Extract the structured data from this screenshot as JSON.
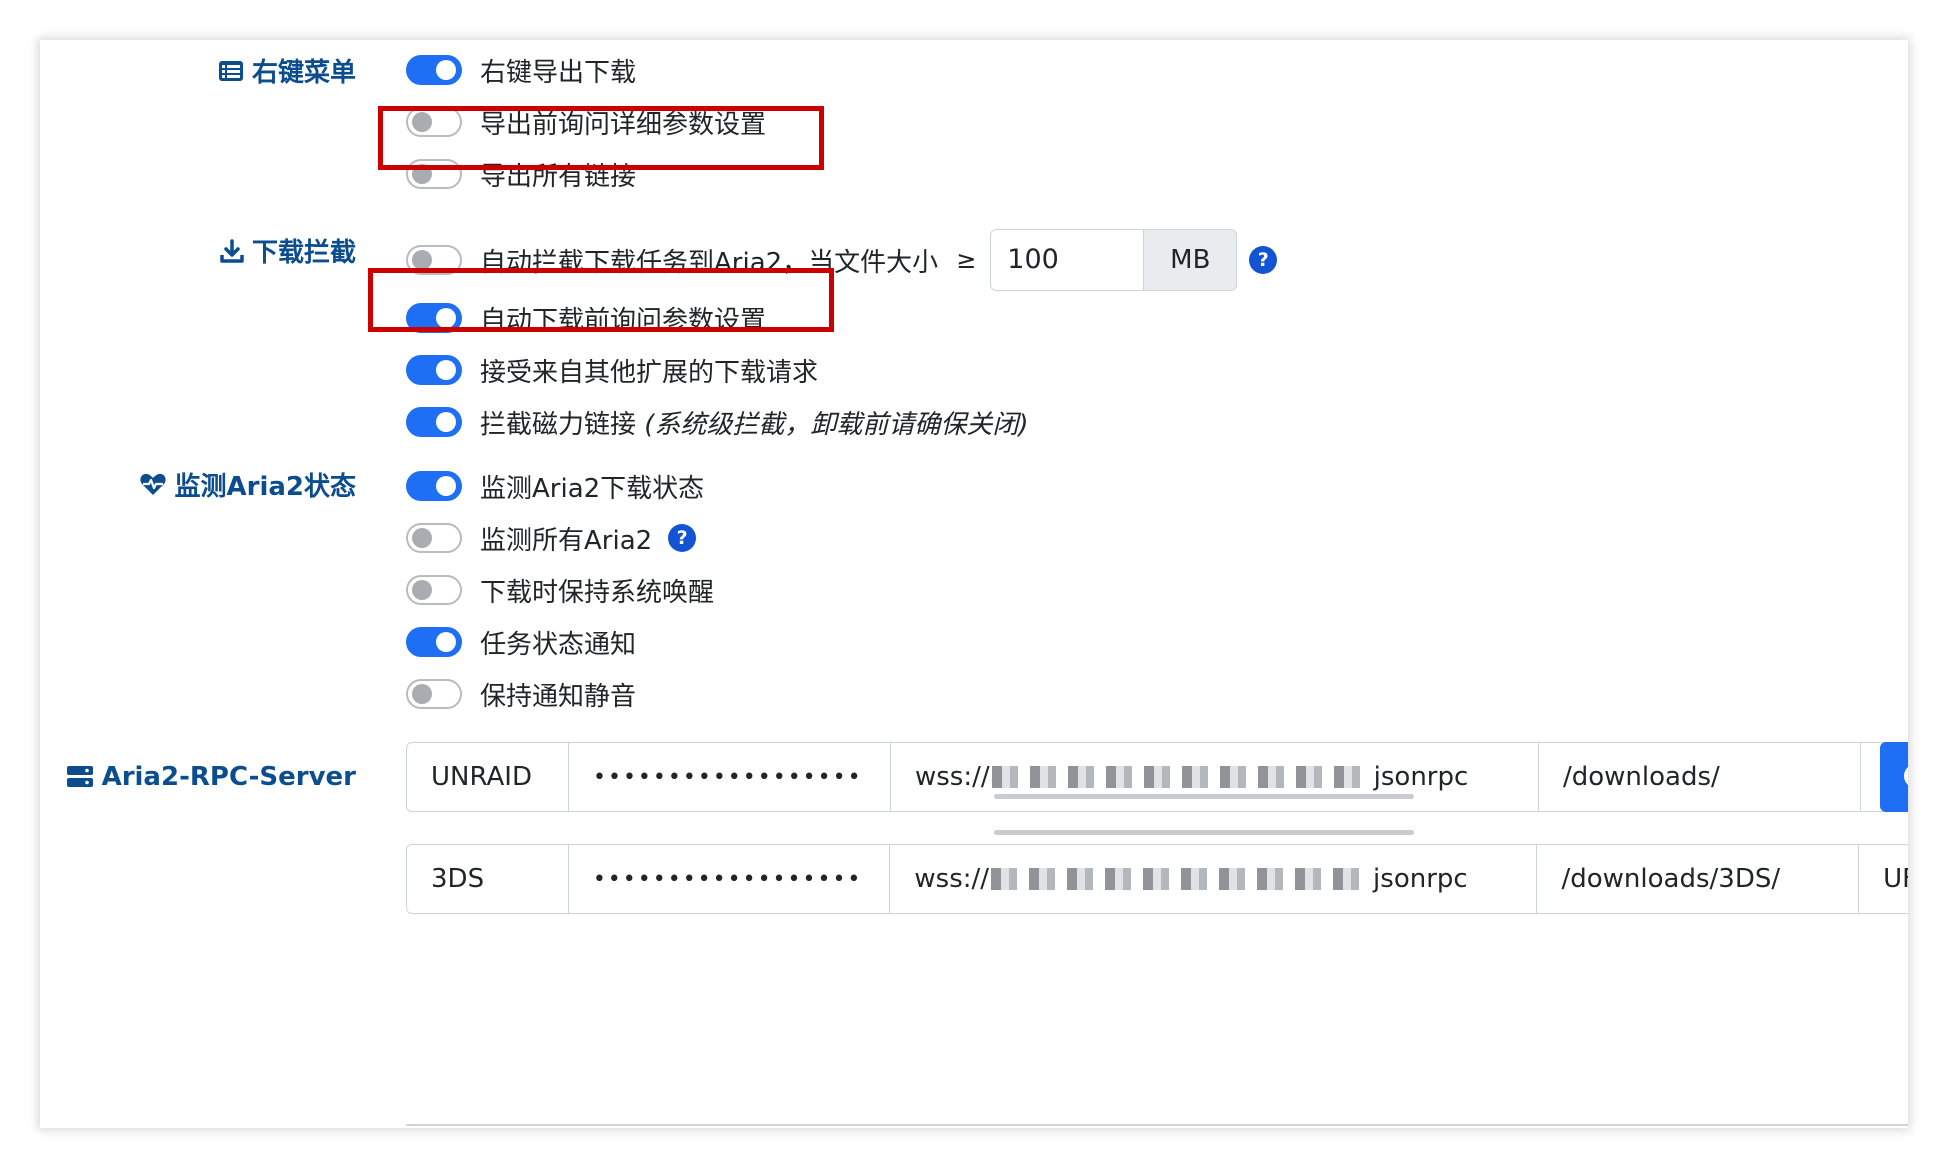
{
  "sections": {
    "context_menu": {
      "label": "右键菜单",
      "icon": "list-icon",
      "options": [
        {
          "label": "右键导出下载",
          "enabled": true
        },
        {
          "label": "导出前询问详细参数设置",
          "enabled": false
        },
        {
          "label": "导出所有链接",
          "enabled": false
        }
      ]
    },
    "intercept": {
      "label": "下载拦截",
      "icon": "download-icon",
      "auto_intercept": {
        "label": "自动拦截下载任务到Aria2，当文件大小",
        "comparator": "≥",
        "size_value": "100",
        "size_unit": "MB",
        "enabled": false,
        "help": "?"
      },
      "options": [
        {
          "label": "自动下载前询问参数设置",
          "enabled": true
        },
        {
          "label": "接受来自其他扩展的下载请求",
          "enabled": true
        },
        {
          "label": "拦截磁力链接",
          "note": "(系统级拦截，卸载前请确保关闭)",
          "enabled": true
        }
      ]
    },
    "monitor": {
      "label": "监测Aria2状态",
      "icon": "heartbeat-icon",
      "options": [
        {
          "label": "监测Aria2下载状态",
          "enabled": true
        },
        {
          "label": "监测所有Aria2",
          "enabled": false,
          "help": "?"
        },
        {
          "label": "下载时保持系统唤醒",
          "enabled": false
        },
        {
          "label": "任务状态通知",
          "enabled": true
        },
        {
          "label": "保持通知静音",
          "enabled": false
        }
      ]
    },
    "rpc": {
      "label": "Aria2-RPC-Server",
      "icon": "server-icon",
      "servers": [
        {
          "name": "UNRAID",
          "secret": "••••••••••••••••••",
          "url_prefix": "wss://",
          "url_suffix": "jsonrpc",
          "path": "/downloads/",
          "extra": ""
        },
        {
          "name": "3DS",
          "secret": "••••••••••••••••••",
          "url_prefix": "wss://",
          "url_suffix": "jsonrpc",
          "path": "/downloads/3DS/",
          "extra": "UF"
        }
      ]
    }
  },
  "colors": {
    "accent": "#1f6ff5",
    "section_label": "#0b4d8f",
    "highlight": "#cc0000",
    "help_badge": "#1454d4"
  }
}
